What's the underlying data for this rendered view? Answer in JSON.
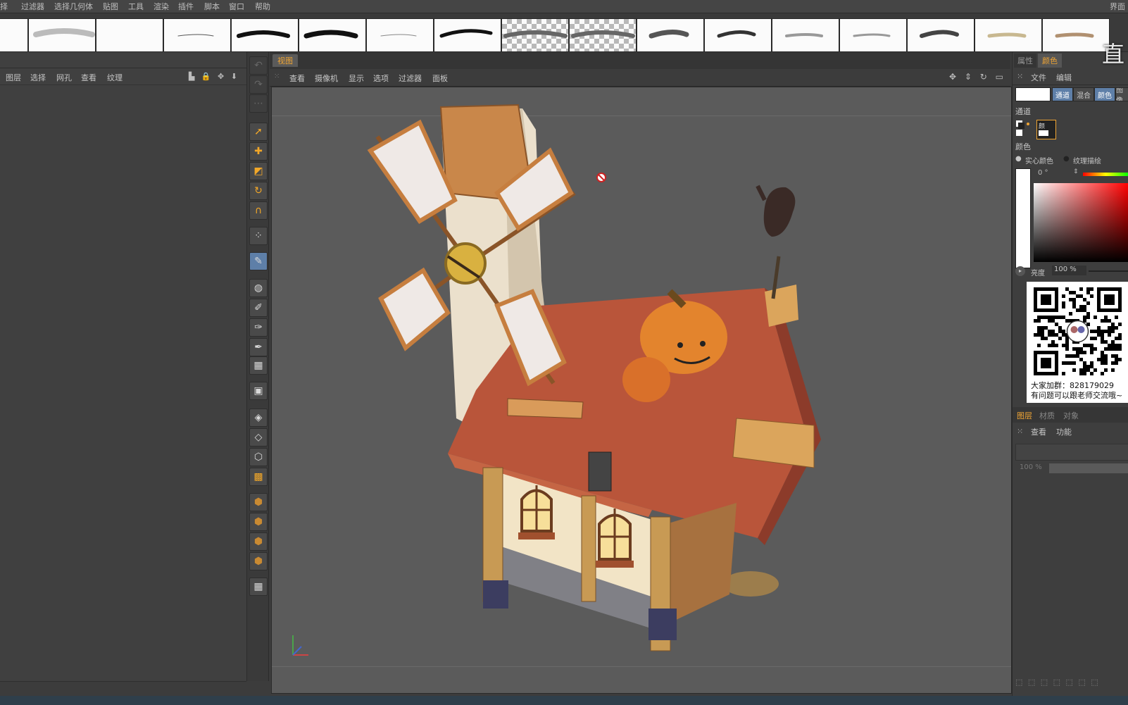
{
  "menubar": {
    "items": [
      "择",
      "过滤器",
      "选择几何体",
      "贴图",
      "工具",
      "渲染",
      "插件",
      "脚本",
      "窗口",
      "帮助"
    ],
    "right_label": "界面"
  },
  "brushes": [
    "stroke-1",
    "stroke-2",
    "stroke-3",
    "stroke-4",
    "stroke-5",
    "stroke-6",
    "stroke-7",
    "stroke-8",
    "stroke-9",
    "stroke-10",
    "stroke-11",
    "stroke-12",
    "stroke-13",
    "stroke-14",
    "stroke-15",
    "stroke-16",
    "stroke-17"
  ],
  "left_panel": {
    "menu": [
      "图层",
      "选择",
      "网孔",
      "查看",
      "纹理"
    ],
    "tool_icons": "▙ 🔒 ✥ ⬇"
  },
  "toolbar": {
    "tools": [
      {
        "name": "undo-tool-icon",
        "glyph": "↶",
        "style": "dim"
      },
      {
        "name": "redo-tool-icon",
        "glyph": "↷",
        "style": "dim"
      },
      {
        "name": "dotted-tool-icon",
        "glyph": "⋯",
        "style": "dim"
      },
      {
        "name": "select-tool-icon",
        "glyph": "➚",
        "style": "orange"
      },
      {
        "name": "move-tool-icon",
        "glyph": "✚",
        "style": "orange"
      },
      {
        "name": "scale-tool-icon",
        "glyph": "◩",
        "style": "orange"
      },
      {
        "name": "rotate-tool-icon",
        "glyph": "↻",
        "style": "orange"
      },
      {
        "name": "magnet-tool-icon",
        "glyph": "∩",
        "style": "orange"
      },
      {
        "name": "points-tool-icon",
        "glyph": "⁘",
        "style": ""
      },
      {
        "name": "paint-brush-tool-icon",
        "glyph": "✎",
        "style": "active"
      },
      {
        "name": "fill-tool-icon",
        "glyph": "◍",
        "style": ""
      },
      {
        "name": "eyedropper-tool-icon",
        "glyph": "✐",
        "style": ""
      },
      {
        "name": "smudge-tool-icon",
        "glyph": "✑",
        "style": ""
      },
      {
        "name": "clone-tool-icon",
        "glyph": "✒",
        "style": ""
      },
      {
        "name": "checker-tool-icon",
        "glyph": "▦",
        "style": ""
      },
      {
        "name": "layer-mask-tool-icon",
        "glyph": "▣",
        "style": ""
      },
      {
        "name": "projection-tool-icon",
        "glyph": "◈",
        "style": ""
      },
      {
        "name": "uv-tool-icon",
        "glyph": "◇",
        "style": ""
      },
      {
        "name": "polygon-tool-icon",
        "glyph": "⬡",
        "style": ""
      },
      {
        "name": "texture-checker-icon",
        "glyph": "▩",
        "style": "orange"
      },
      {
        "name": "cube-mode-1-icon",
        "glyph": "⬢",
        "style": "cube"
      },
      {
        "name": "cube-mode-2-icon",
        "glyph": "⬢",
        "style": "cube"
      },
      {
        "name": "cube-mode-3-icon",
        "glyph": "⬢",
        "style": "cube"
      },
      {
        "name": "cube-mode-4-icon",
        "glyph": "⬢",
        "style": "cube"
      },
      {
        "name": "render-region-icon",
        "glyph": "▦",
        "style": ""
      }
    ]
  },
  "viewport": {
    "tab": "视图",
    "menu": [
      "查看",
      "摄像机",
      "显示",
      "选项",
      "过滤器",
      "面板"
    ],
    "nav_icons": "✥ ⇕ ↻ ▭"
  },
  "right_panel": {
    "tabs": [
      "属性",
      "颜色"
    ],
    "menu": [
      "文件",
      "编辑"
    ],
    "modes": [
      "通道",
      "混合",
      "颜色",
      "图像"
    ],
    "channel_label": "通道",
    "channel_box": "颜",
    "color_label": "颜色",
    "solid_color": "实心颜色",
    "texture_color": "纹理描绘",
    "hue_value": "0 °",
    "brightness_label": "亮度",
    "brightness_value": "100 %",
    "qr_caption_1": "大家加群：828179029",
    "qr_caption_2": "有问题可以跟老师交流哦~",
    "layer_tabs": [
      "图层",
      "材质",
      "对象"
    ],
    "layer_menu": [
      "查看",
      "功能"
    ],
    "opacity_value": "100 %",
    "accent_color": "#f0a534"
  },
  "watermark": "直"
}
